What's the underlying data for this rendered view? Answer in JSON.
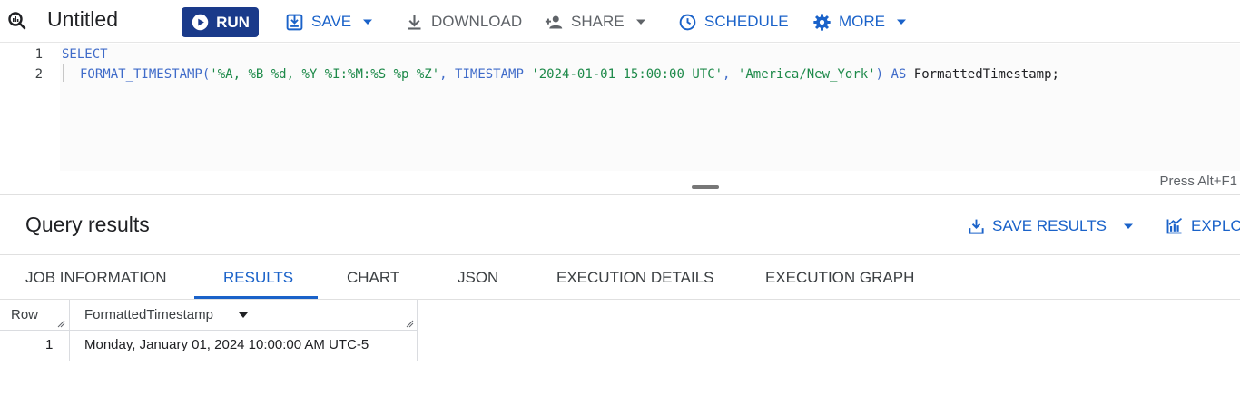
{
  "toolbar": {
    "title": "Untitled",
    "run_label": "RUN",
    "save_label": "SAVE",
    "download_label": "DOWNLOAD",
    "share_label": "SHARE",
    "schedule_label": "SCHEDULE",
    "more_label": "MORE",
    "icons": {
      "tab": "query-icon",
      "run": "play-icon",
      "save": "save-icon",
      "download": "download-icon",
      "share": "add-person-icon",
      "schedule": "clock-icon",
      "more": "gear-icon"
    }
  },
  "editor": {
    "line_numbers": [
      "1",
      "2"
    ],
    "lines": [
      [
        {
          "t": "SELECT",
          "c": "kw"
        }
      ],
      [
        {
          "t": "FORMAT_TIMESTAMP(",
          "c": "fn"
        },
        {
          "t": "'%A, %B %d, %Y %I:%M:%S %p %Z'",
          "c": "str"
        },
        {
          "t": ", ",
          "c": "fn"
        },
        {
          "t": "TIMESTAMP ",
          "c": "kw"
        },
        {
          "t": "'2024-01-01 15:00:00 UTC'",
          "c": "str"
        },
        {
          "t": ", ",
          "c": "fn"
        },
        {
          "t": "'America/New_York'",
          "c": "str"
        },
        {
          "t": ") ",
          "c": "fn"
        },
        {
          "t": "AS ",
          "c": "kw"
        },
        {
          "t": "FormattedTimestamp;",
          "c": "plain"
        }
      ]
    ],
    "hint": "Press Alt+F1"
  },
  "results": {
    "title": "Query results",
    "save_results_label": "SAVE RESULTS",
    "explore_label": "EXPLOR",
    "tabs": [
      {
        "label": "JOB INFORMATION",
        "active": false
      },
      {
        "label": "RESULTS",
        "active": true
      },
      {
        "label": "CHART",
        "active": false
      },
      {
        "label": "JSON",
        "active": false
      },
      {
        "label": "EXECUTION DETAILS",
        "active": false
      },
      {
        "label": "EXECUTION GRAPH",
        "active": false
      }
    ],
    "table": {
      "columns": [
        "Row",
        "FormattedTimestamp"
      ],
      "rows": [
        [
          "1",
          "Monday, January 01, 2024 10:00:00 AM UTC-5"
        ]
      ]
    }
  },
  "colors": {
    "primary": "#1a62c9",
    "run_button": "#1a3a8a",
    "string_literal": "#1e8a4a",
    "keyword": "#3f6bc9"
  }
}
